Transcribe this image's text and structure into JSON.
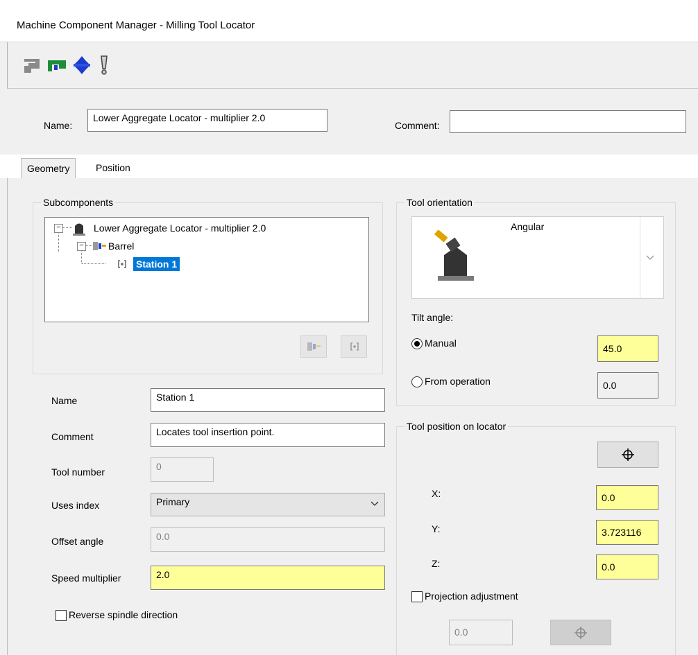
{
  "window": {
    "title": "Machine Component Manager - Milling Tool Locator"
  },
  "toolbar": {
    "icons": [
      "locator-corner-icon",
      "locator-green-icon",
      "locator-blue-icon",
      "probe-icon"
    ]
  },
  "header": {
    "name_label": "Name:",
    "name_value": "Lower Aggregate Locator - multiplier 2.0",
    "comment_label": "Comment:",
    "comment_value": ""
  },
  "tabs": [
    {
      "label": "Geometry",
      "active": true
    },
    {
      "label": "Position",
      "active": false
    }
  ],
  "subcomponents": {
    "title": "Subcomponents",
    "tree": [
      {
        "label": "Lower Aggregate Locator - multiplier 2.0",
        "level": 0
      },
      {
        "label": "Barrel",
        "level": 1
      },
      {
        "label": "Station 1",
        "level": 2,
        "selected": true
      }
    ]
  },
  "fields": {
    "name": {
      "label": "Name",
      "value": "Station 1"
    },
    "comment": {
      "label": "Comment",
      "value": "Locates tool insertion point."
    },
    "tool_number": {
      "label": "Tool number",
      "value": "0"
    },
    "uses_index": {
      "label": "Uses index",
      "value": "Primary"
    },
    "offset_angle": {
      "label": "Offset angle",
      "value": "0.0"
    },
    "speed_multiplier": {
      "label": "Speed multiplier",
      "value": "2.0"
    },
    "reverse_spindle": {
      "label": "Reverse spindle direction",
      "checked": false
    }
  },
  "orientation": {
    "title": "Tool orientation",
    "selected": "Angular",
    "tilt_label": "Tilt angle:",
    "manual_label": "Manual",
    "manual_value": "45.0",
    "from_op_label": "From operation",
    "from_op_value": "0.0"
  },
  "position": {
    "title": "Tool position on locator",
    "x_label": "X:",
    "x_value": "0.0",
    "y_label": "Y:",
    "y_value": "3.723116",
    "z_label": "Z:",
    "z_value": "0.0",
    "projection_label": "Projection adjustment",
    "projection_checked": false,
    "projection_value": "0.0"
  },
  "colors": {
    "highlight": "#ffff99",
    "selection": "#0078d7"
  }
}
